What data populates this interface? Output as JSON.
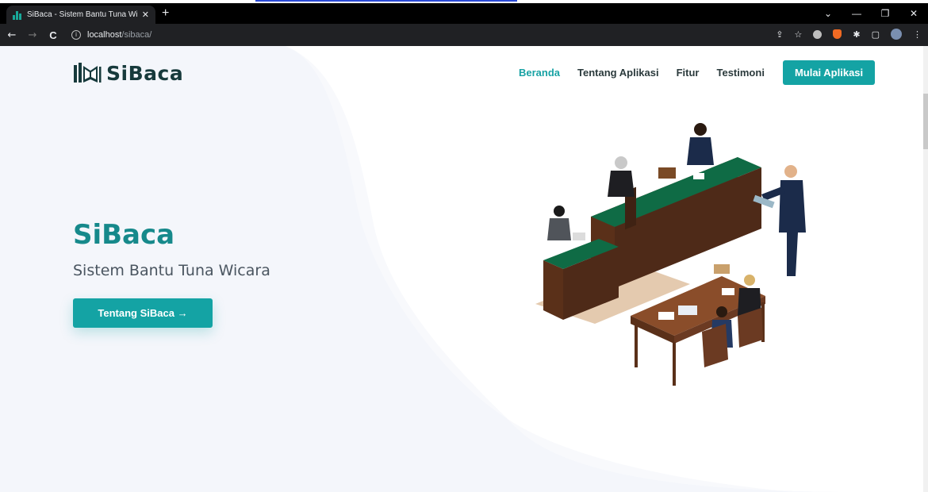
{
  "browser": {
    "tab_title": "SiBaca - Sistem Bantu Tuna Wica",
    "tab_close": "✕",
    "new_tab": "+",
    "url_host": "localhost",
    "url_path": "/sibaca/",
    "window_controls": [
      "⌄",
      "—",
      "❐",
      "✕"
    ],
    "nav_back": "←",
    "nav_forward": "→",
    "nav_reload": "C",
    "share": "⇪",
    "bookmark": "☆",
    "puzzle": "✱",
    "sidepanel": "▢",
    "menu": "⋮"
  },
  "site": {
    "logo_text": "SiBaca",
    "nav": {
      "items": [
        "Beranda",
        "Tentang Aplikasi",
        "Fitur",
        "Testimoni"
      ],
      "cta": "Mulai Aplikasi"
    },
    "hero": {
      "title": "SiBaca",
      "subtitle": "Sistem Bantu Tuna Wicara",
      "button": "Tentang SiBaca →"
    },
    "colors": {
      "accent": "#14a3a4",
      "title": "#16898b",
      "logo": "#173a3c",
      "blob": "#f4f6fb"
    }
  }
}
